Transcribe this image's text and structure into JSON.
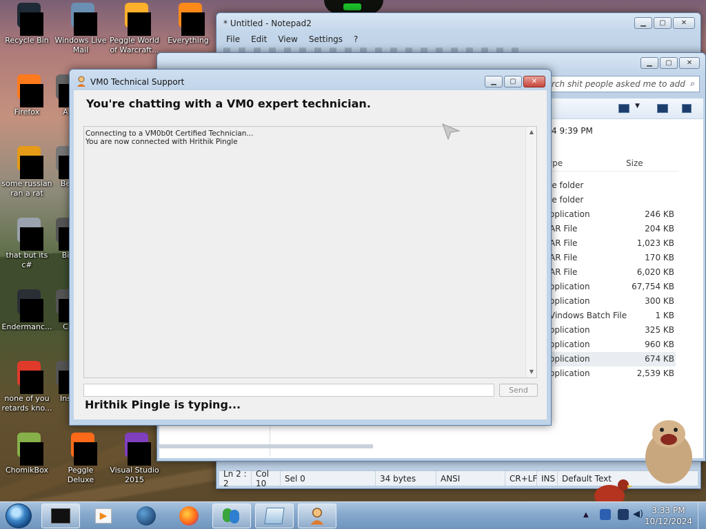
{
  "desktop": {
    "icons": [
      {
        "label": "Recycle Bin"
      },
      {
        "label": "Windows Live Mail"
      },
      {
        "label": "Peggle World of Warcraft..."
      },
      {
        "label": "Everything"
      },
      {
        "label": "Firefox"
      },
      {
        "label": "A"
      },
      {
        "label": "some russian ran a rat"
      },
      {
        "label": "Be"
      },
      {
        "label": "that but its c#"
      },
      {
        "label": "Bi"
      },
      {
        "label": "Endermanc..."
      },
      {
        "label": "C"
      },
      {
        "label": "none of you retards kno..."
      },
      {
        "label": "Ins"
      },
      {
        "label": "ChomikBox"
      },
      {
        "label": "Peggle Deluxe"
      },
      {
        "label": "Visual Studio 2015"
      }
    ]
  },
  "notepad": {
    "title": "* Untitled - Notepad2",
    "menu": [
      "File",
      "Edit",
      "View",
      "Settings",
      "?"
    ],
    "status": {
      "position": "Ln 2 : 2",
      "col": "Col 10",
      "sel": "Sel 0",
      "bytes": "34 bytes",
      "encoding": "ANSI",
      "eol": "CR+LF",
      "mode": "INS",
      "scheme": "Default Text"
    }
  },
  "explorer": {
    "search_placeholder": "rch shit people asked me to add",
    "modified": "4 9:39 PM",
    "columns": {
      "type": "ype",
      "size": "Size"
    },
    "rows": [
      {
        "type": "le folder",
        "size": ""
      },
      {
        "type": "le folder",
        "size": ""
      },
      {
        "type": "oplication",
        "size": "246 KB"
      },
      {
        "type": "AR File",
        "size": "204 KB"
      },
      {
        "type": "AR File",
        "size": "1,023 KB"
      },
      {
        "type": "AR File",
        "size": "170 KB"
      },
      {
        "type": "AR File",
        "size": "6,020 KB"
      },
      {
        "type": "oplication",
        "size": "67,754 KB"
      },
      {
        "type": "oplication",
        "size": "300 KB"
      },
      {
        "type": "Vindows Batch File",
        "size": "1 KB"
      },
      {
        "type": "oplication",
        "size": "325 KB"
      },
      {
        "type": "oplication",
        "size": "960 KB"
      },
      {
        "type": "oplication",
        "size": "674 KB"
      },
      {
        "type": "oplication",
        "size": "2,539 KB"
      }
    ],
    "selected_row": 12
  },
  "chat": {
    "title": "VM0 Technical Support",
    "heading": "You're chatting with a VM0 expert technician.",
    "log": [
      "Connecting to a VM0b0t Certified Technician...",
      "You are now connected with Hrithik Pingle"
    ],
    "input_value": "",
    "send_label": "Send",
    "typing": "Hrithik Pingle is typing..."
  },
  "taskbar": {
    "time": "3:33 PM",
    "date": "10/12/2024"
  },
  "colors": {
    "taskbar": "#86a8cc",
    "window_frame": "#c3d6ea",
    "close_button": "#c7443a"
  }
}
